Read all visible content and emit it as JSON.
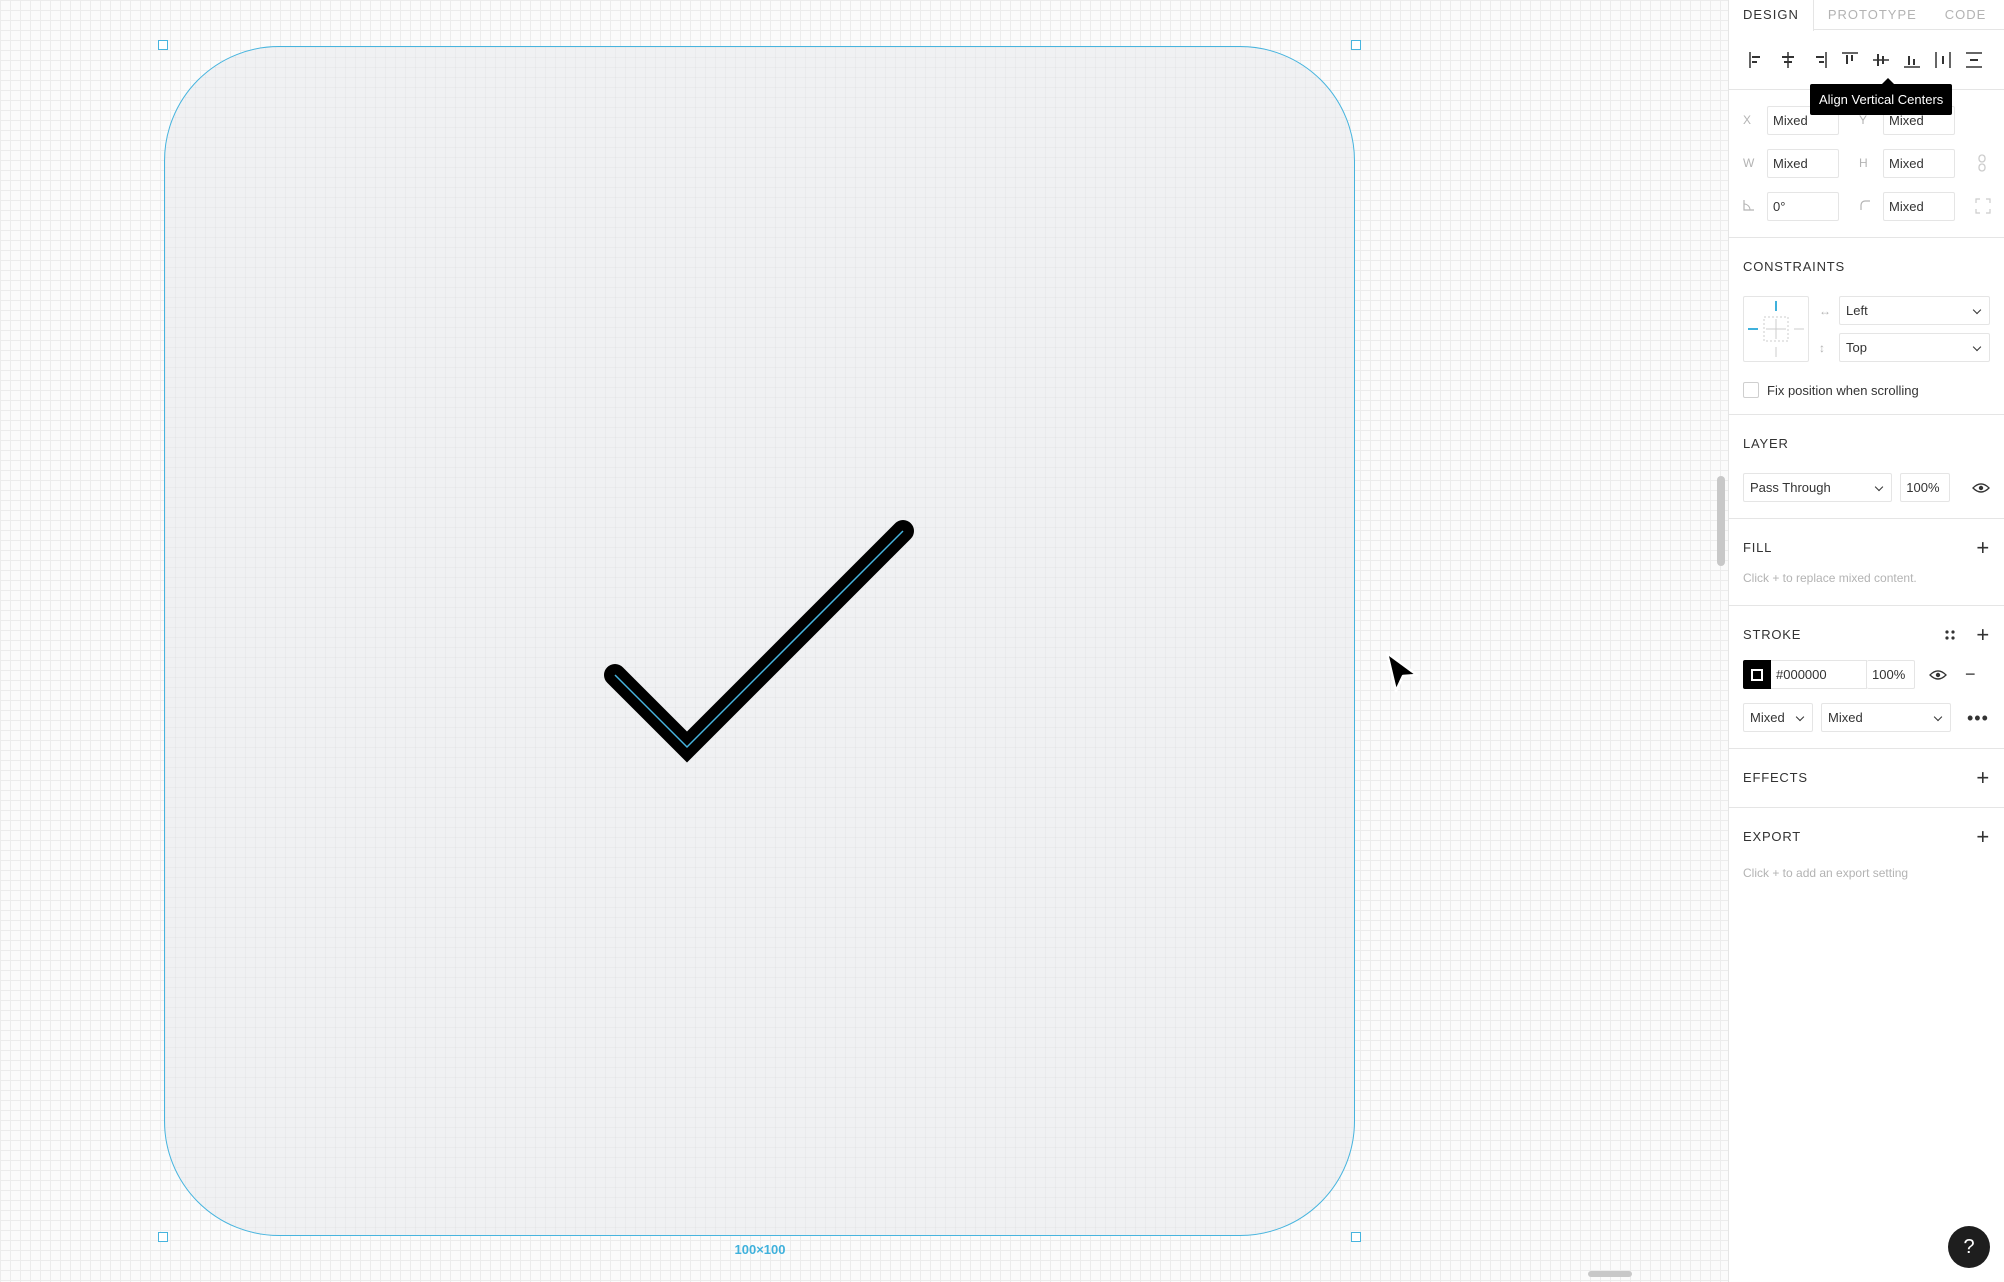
{
  "canvas": {
    "frame_size_label": "100×100"
  },
  "panel": {
    "tabs": [
      "DESIGN",
      "PROTOTYPE",
      "CODE"
    ],
    "active_tab": "DESIGN",
    "tooltip": "Align Vertical Centers",
    "geometry": {
      "x_label": "X",
      "x_value": "Mixed",
      "y_label": "Y",
      "y_value": "Mixed",
      "w_label": "W",
      "w_value": "Mixed",
      "h_label": "H",
      "h_value": "Mixed",
      "rotation_value": "0°",
      "radius_value": "Mixed"
    },
    "constraints": {
      "title": "CONSTRAINTS",
      "horizontal": "Left",
      "vertical": "Top",
      "fix_position_label": "Fix position when scrolling"
    },
    "layer": {
      "title": "LAYER",
      "blend_mode": "Pass Through",
      "opacity": "100%"
    },
    "fill": {
      "title": "FILL",
      "hint": "Click + to replace mixed content."
    },
    "stroke": {
      "title": "STROKE",
      "color_hex": "#000000",
      "opacity": "100%",
      "weight": "Mixed",
      "style": "Mixed"
    },
    "effects": {
      "title": "EFFECTS"
    },
    "export": {
      "title": "EXPORT",
      "hint": "Click + to add an export setting"
    },
    "help_label": "?"
  },
  "colors": {
    "selection": "#47b4de",
    "frame_fill": "#f0f1f3",
    "stroke": "#000000"
  }
}
